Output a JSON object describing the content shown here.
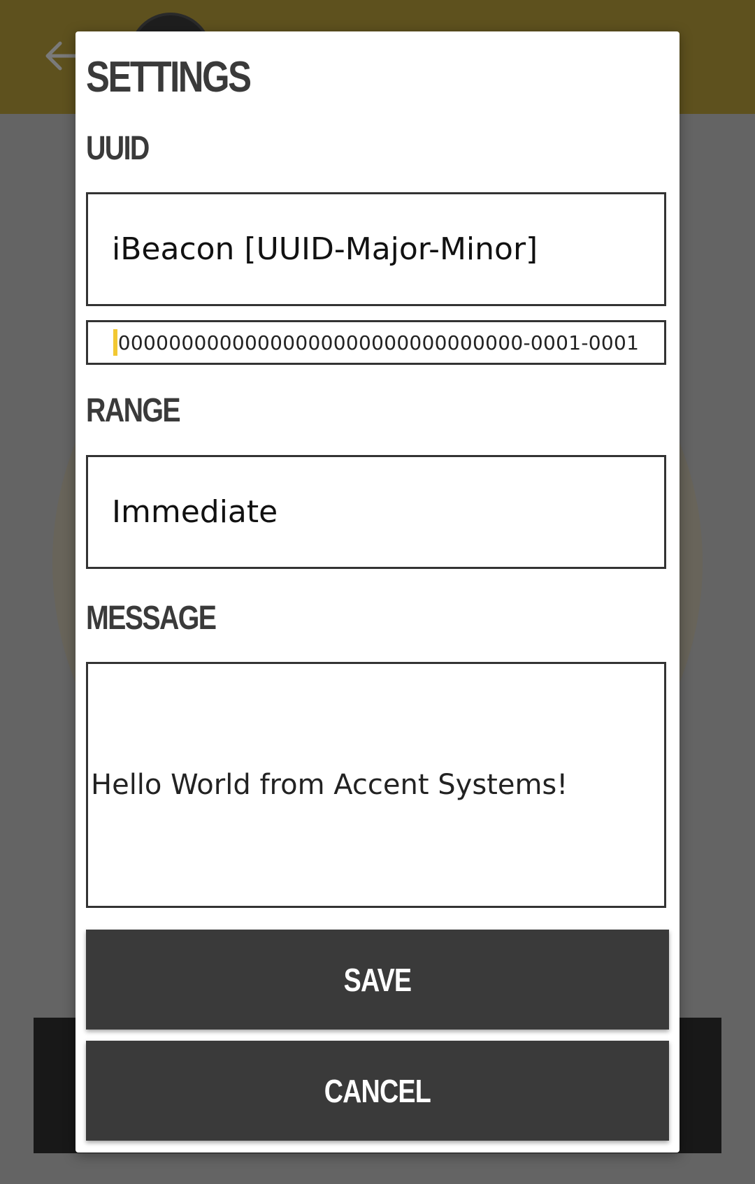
{
  "dialog": {
    "title": "SETTINGS",
    "uuid": {
      "label": "UUID",
      "format_value": "iBeacon [UUID-Major-Minor]",
      "input_value": "00000000000000000000000000000000-0001-0001"
    },
    "range": {
      "label": "RANGE",
      "value": "Immediate"
    },
    "message": {
      "label": "MESSAGE",
      "value": "Hello World from Accent Systems!"
    },
    "save_label": "SAVE",
    "cancel_label": "CANCEL"
  },
  "icons": {
    "back": "arrow-left-icon",
    "caret": "text-cursor"
  },
  "colors": {
    "toolbar": "#5e511e",
    "button": "#3a3a3a",
    "caret": "#f2c832"
  }
}
